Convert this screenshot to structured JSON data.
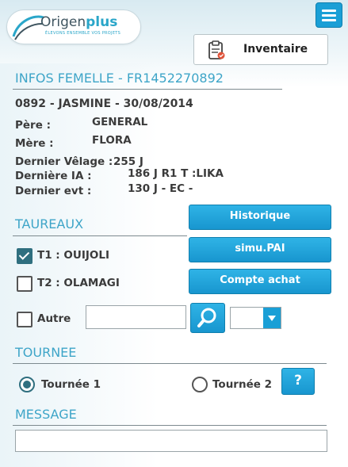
{
  "header": {
    "logo_text_a": "Origen",
    "logo_text_b": "plus",
    "logo_tagline": "ÉLEVONS ENSEMBLE VOS PROJETS",
    "inventory_label": "Inventaire"
  },
  "infos": {
    "title": "INFOS FEMELLE - FR1452270892",
    "summary": "0892 - JASMINE - 30/08/2014",
    "pere_label": "Père :",
    "pere_value": "GENERAL",
    "mere_label": "Mère :",
    "mere_value": "FLORA",
    "velage_label": "Dernier Vêlage :",
    "velage_value": "255 J",
    "ia_label": "Dernière IA :",
    "ia_value": "186 J R1 T :LIKA",
    "evt_label": "Dernier evt :",
    "evt_value": "130 J - EC -"
  },
  "taureaux": {
    "title": "TAUREAUX",
    "t1_label": "T1 : OUIJOLI",
    "t1_checked": true,
    "t2_label": "T2 : OLAMAGI",
    "t2_checked": false,
    "autre_label": "Autre",
    "autre_checked": false,
    "autre_value": "",
    "historique_label": "Historique",
    "simu_label": "simu.PAI",
    "compte_label": "Compte achat",
    "select_value": ""
  },
  "tournee": {
    "title": "TOURNEE",
    "t1_label": "Tournée 1",
    "t2_label": "Tournée 2",
    "selected": "Tournée 1",
    "help_label": "?"
  },
  "message": {
    "title": "MESSAGE",
    "value": ""
  },
  "colors": {
    "accent": "#1a9fd6",
    "section_title": "#3ea5c8",
    "checked": "#2f6f7f"
  }
}
